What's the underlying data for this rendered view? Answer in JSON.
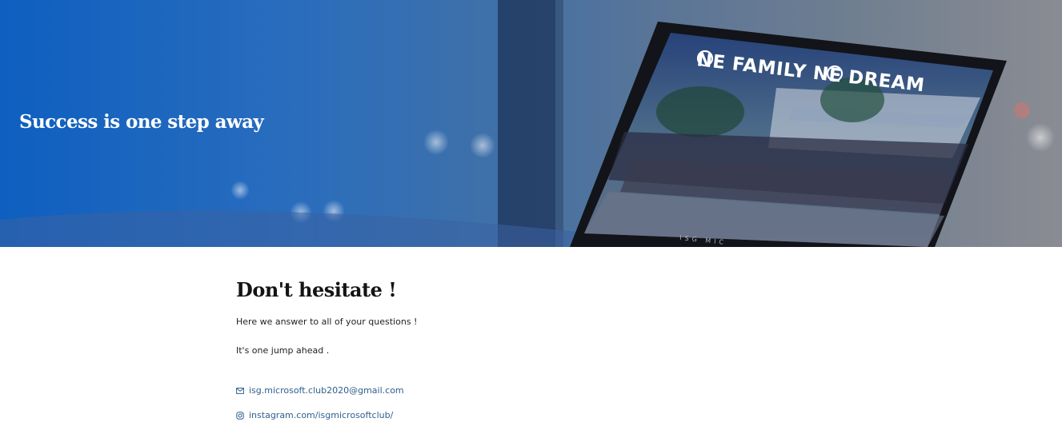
{
  "hero": {
    "title": "Success is one step away",
    "screen_text": "NE FAMILY NE DREAM",
    "screen_monogram": "M",
    "screen_footer": "ISG MIC"
  },
  "section": {
    "heading": "Don't hesitate !",
    "line1": "Here we answer to all of your questions !",
    "line2": "It's one jump ahead ."
  },
  "contact": {
    "email": "isg.microsoft.club2020@gmail.com",
    "email_icon": "envelope-icon",
    "instagram": "instagram.com/isgmicrosoftclub/",
    "instagram_icon": "instagram-icon",
    "link_color": "#2f5f8e"
  }
}
